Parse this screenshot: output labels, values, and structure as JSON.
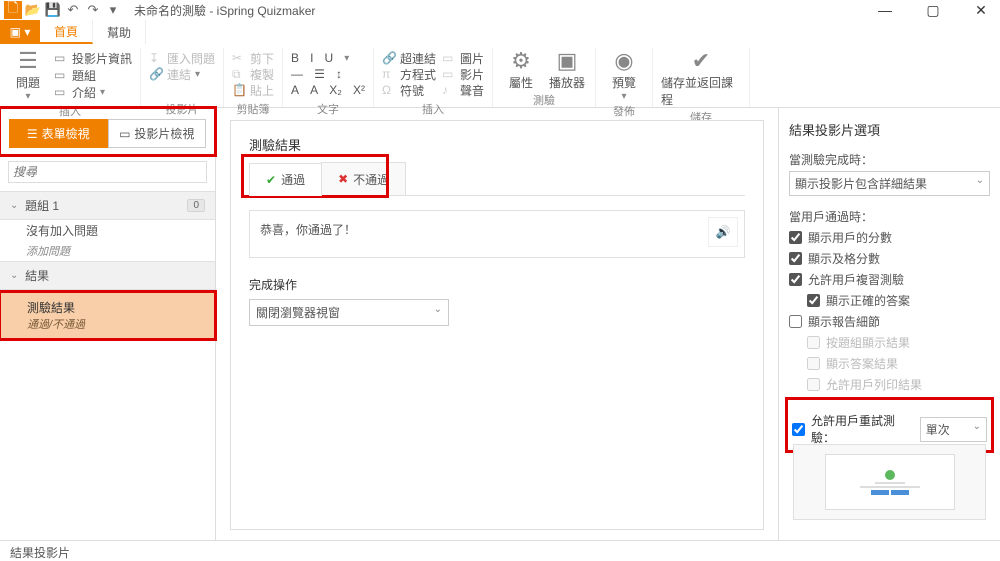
{
  "title": "未命名的測驗 - iSpring Quizmaker",
  "win": {
    "min": "—",
    "max": "▢",
    "close": "✕"
  },
  "qa": {
    "new": "🗋",
    "open": "📂",
    "save": "💾",
    "undo": "↶",
    "redo": "↷",
    "down": "▾"
  },
  "tabs": {
    "home": "首頁",
    "help": "幫助"
  },
  "ribbon": {
    "g1": {
      "big": "問題",
      "r1": "投影片資訊",
      "r2": "題組",
      "r3": "介紹",
      "label": "插入"
    },
    "g2": {
      "r1": "匯入問題",
      "r2": "連結",
      "label": "投影片"
    },
    "g3": {
      "r1": "剪下",
      "r2": "複製",
      "r3": "貼上",
      "label": "剪貼簿"
    },
    "g4": {
      "label": "文字"
    },
    "g5": {
      "r1": "超連結",
      "r2": "方程式",
      "r3": "符號",
      "c1": "圖片",
      "c2": "影片",
      "c3": "聲音",
      "label": "插入"
    },
    "g6": {
      "b1": "屬性",
      "b2": "播放器",
      "label": "測驗"
    },
    "g7": {
      "b1": "預覽",
      "label": "發佈"
    },
    "g8": {
      "b1": "儲存並返回課程",
      "label": "儲存"
    }
  },
  "left": {
    "view1": "表單檢視",
    "view2": "投影片檢視",
    "search": "搜尋",
    "grp": "題組 1",
    "grpCount": "0",
    "noq": "沒有加入問題",
    "addq": "添加問題",
    "results": "結果",
    "resName": "測驗結果",
    "resSub": "通過/不通過"
  },
  "center": {
    "title": "測驗結果",
    "tabPass": "通過",
    "tabFail": "不通過",
    "msg": "恭喜，你通過了！",
    "section": "完成操作",
    "action": "關閉瀏覽器視窗"
  },
  "right": {
    "title": "結果投影片選項",
    "l1": "當測驗完成時：",
    "sel1": "顯示投影片包含詳細結果",
    "l2": "當用戶通過時：",
    "c1": "顯示用戶的分數",
    "c2": "顯示及格分數",
    "c3": "允許用戶複習測驗",
    "c3a": "顯示正確的答案",
    "c4": "顯示報告細節",
    "c4a": "按題組顯示結果",
    "c4b": "顯示答案結果",
    "c4c": "允許用戶列印結果",
    "retry": "允許用戶重試測驗：",
    "retrySel": "單次"
  },
  "status": "結果投影片"
}
